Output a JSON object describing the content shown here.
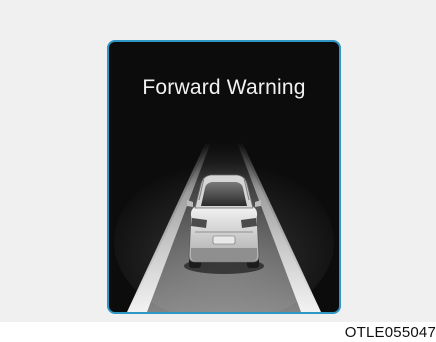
{
  "display": {
    "title": "Forward Warning",
    "scene_icon": "vehicle-ahead-on-road-icon",
    "colors": {
      "frame_border": "#2e97c3",
      "screen_background": "#0c0c0c",
      "text": "#f2f2f2",
      "panel_background": "#f0f0f0"
    }
  },
  "caption": "OTLE055047"
}
